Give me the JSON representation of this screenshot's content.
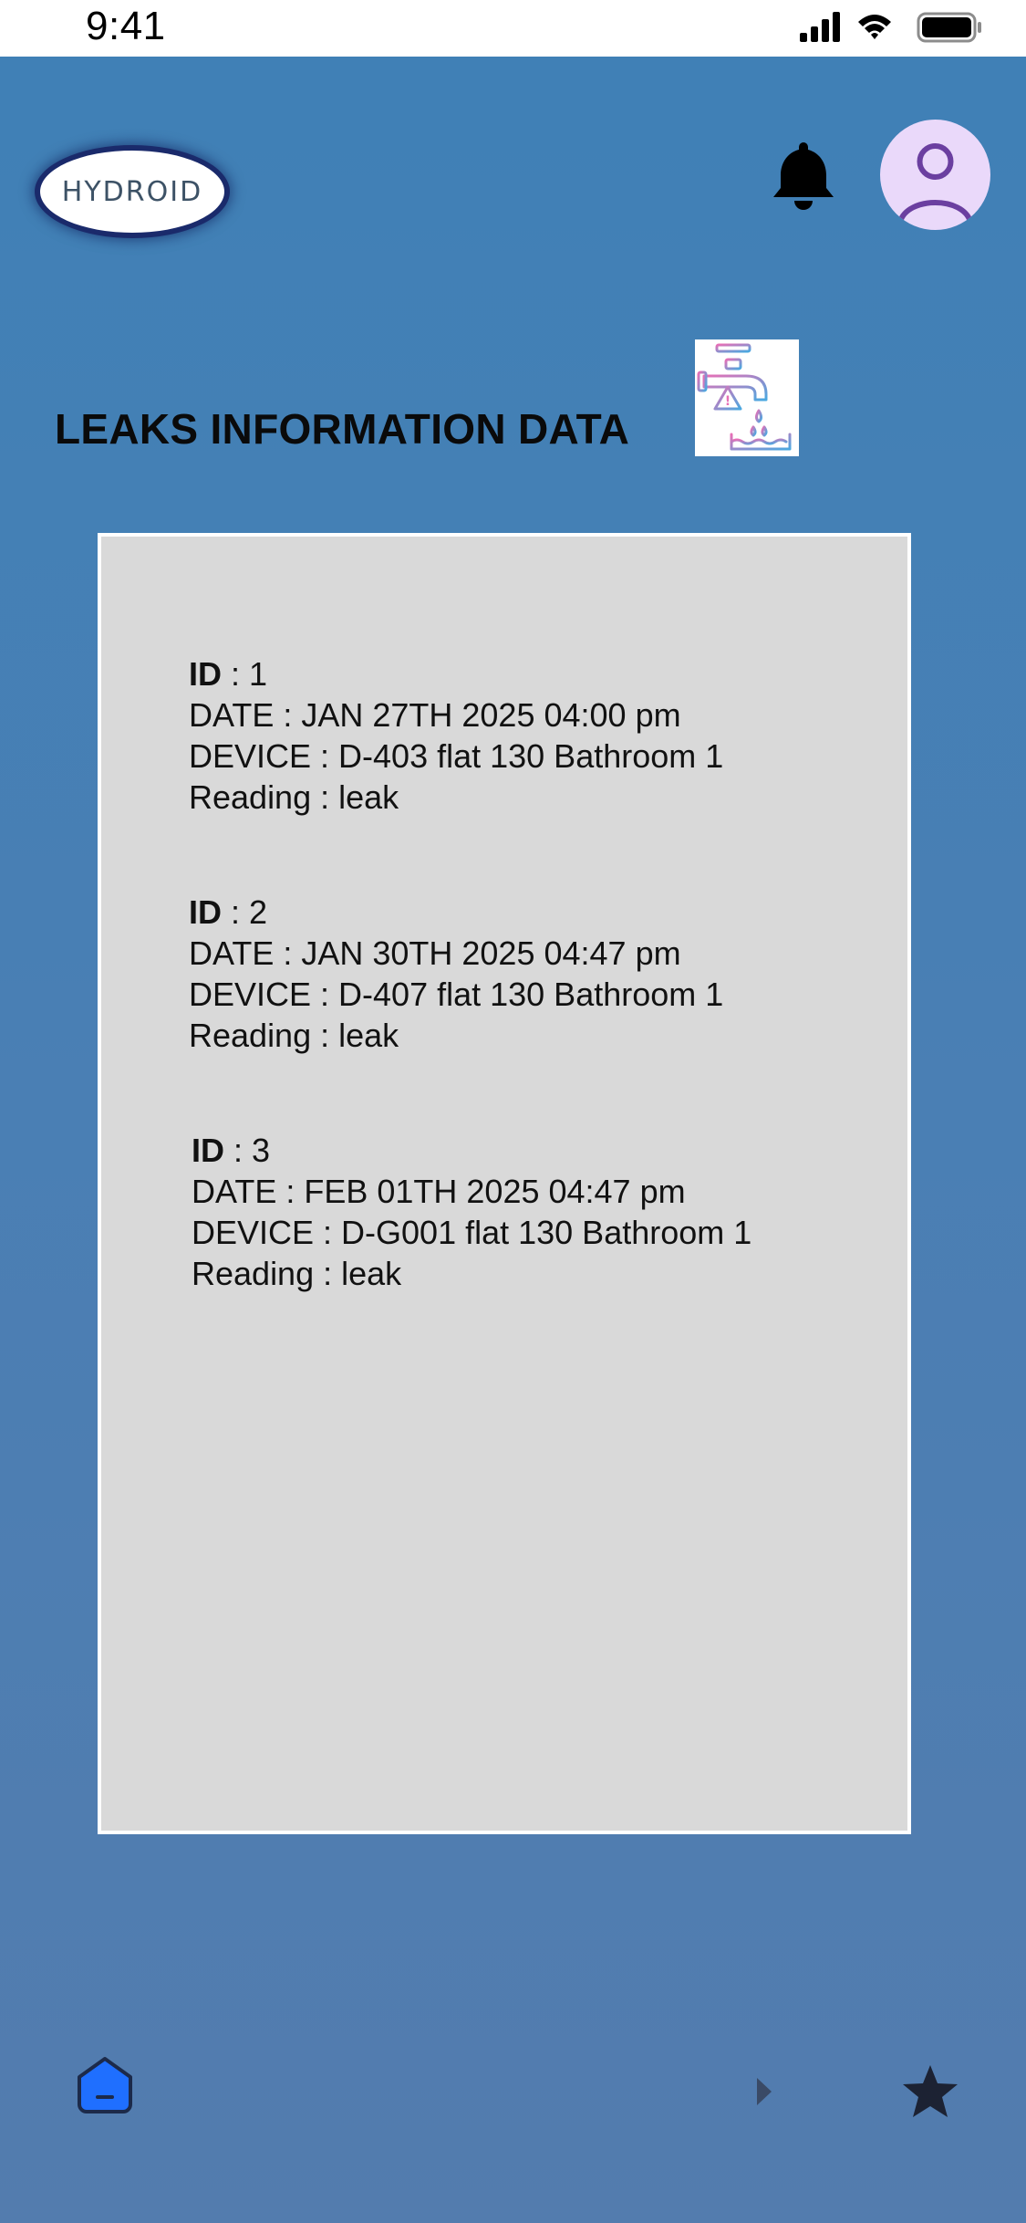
{
  "status_bar": {
    "time": "9:41"
  },
  "header": {
    "logo_text": "HYDROID",
    "bell_icon": "bell-icon",
    "avatar_icon": "user-avatar-icon"
  },
  "page": {
    "title": "LEAKS INFORMATION DATA",
    "title_image": "leaking-faucet-warning-icon"
  },
  "records": [
    {
      "id_label": "ID",
      "id_value": " : 1",
      "date": "DATE : JAN 27TH 2025 04:00 pm",
      "device": "DEVICE : D-403 flat 130 Bathroom 1",
      "reading": "Reading : leak"
    },
    {
      "id_label": "ID",
      "id_value": " : 2",
      "date": "DATE : JAN 30TH 2025 04:47 pm",
      "device": "DEVICE : D-407 flat 130 Bathroom 1",
      "reading": "Reading : leak"
    },
    {
      "id_label": "ID",
      "id_value": " : 3",
      "date": "DATE : FEB 01TH 2025 04:47 pm",
      "device": "DEVICE : D-G001 flat 130 Bathroom 1",
      "reading": "Reading : leak"
    }
  ],
  "bottom_nav": {
    "home_icon": "home-icon",
    "next_icon": "play-arrow-icon",
    "star_icon": "star-icon"
  },
  "colors": {
    "background_top": "#3f80b6",
    "background_bottom": "#537cae",
    "card": "#d9d9d9",
    "avatar_bg": "#ead9fa",
    "avatar_fg": "#6b3fa0",
    "home_accent": "#1f6fff"
  }
}
